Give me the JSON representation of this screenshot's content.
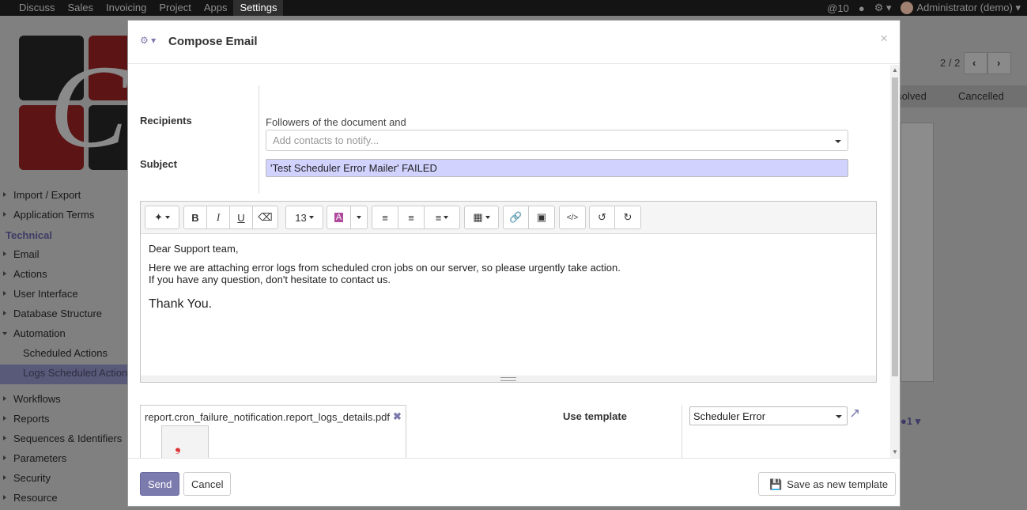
{
  "navbar": {
    "menu": [
      "Discuss",
      "Sales",
      "Invoicing",
      "Project",
      "Apps",
      "Settings"
    ],
    "active": "Settings",
    "mentions": "10",
    "user": "Administrator (demo)"
  },
  "sidebar": {
    "items": [
      {
        "label": "Import / Export",
        "kind": "collapsed"
      },
      {
        "label": "Application Terms",
        "kind": "collapsed"
      },
      {
        "label": "Technical",
        "kind": "section"
      },
      {
        "label": "Email",
        "kind": "collapsed"
      },
      {
        "label": "Actions",
        "kind": "collapsed"
      },
      {
        "label": "User Interface",
        "kind": "collapsed"
      },
      {
        "label": "Database Structure",
        "kind": "collapsed"
      },
      {
        "label": "Automation",
        "kind": "expanded"
      },
      {
        "label": "Scheduled Actions",
        "kind": "sub"
      },
      {
        "label": "Logs Scheduled Actions",
        "kind": "sub-selected"
      },
      {
        "label": "Workflows",
        "kind": "collapsed"
      },
      {
        "label": "Reports",
        "kind": "collapsed"
      },
      {
        "label": "Sequences & Identifiers",
        "kind": "collapsed"
      },
      {
        "label": "Parameters",
        "kind": "collapsed"
      },
      {
        "label": "Security",
        "kind": "collapsed"
      },
      {
        "label": "Resource",
        "kind": "collapsed"
      }
    ]
  },
  "background": {
    "pager": "2 / 2",
    "status_resolved": "esolved",
    "status_cancelled": "Cancelled",
    "follower_count": "1"
  },
  "modal": {
    "title": "Compose Email",
    "close": "×",
    "recipients_label": "Recipients",
    "followers_text": "Followers of the document and",
    "contacts_placeholder": "Add contacts to notify...",
    "subject_label": "Subject",
    "subject_value": "'Test Scheduler Error Mailer' FAILED",
    "editor": {
      "font_size": "13",
      "greeting": "Dear Support team,",
      "line1": "Here we are attaching error logs from scheduled cron jobs on our server, so please urgently take action.",
      "line2": "If you have any question, don't hesitate to contact us.",
      "closing": "Thank You."
    },
    "attachment": {
      "filename": "report.cron_failure_notification.report_logs_details.pdf",
      "remove": "✖"
    },
    "template_label": "Use template",
    "template_value": "Scheduler Error",
    "buttons": {
      "send": "Send",
      "cancel": "Cancel",
      "save_template": "Save as new template"
    }
  }
}
